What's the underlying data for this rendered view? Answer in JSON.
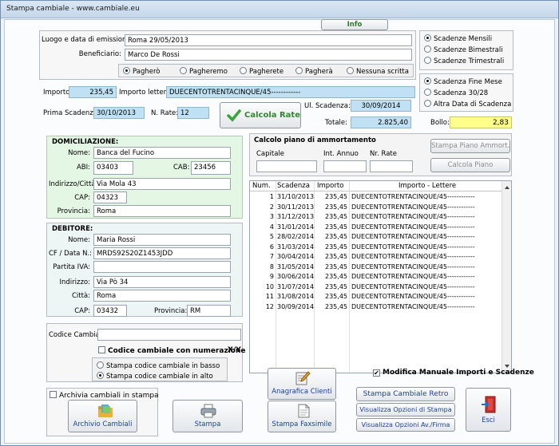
{
  "window": {
    "title": "Stampa cambiale - www.cambiale.eu"
  },
  "tabs": {
    "info_label": "Info"
  },
  "form": {
    "luogo_label": "Luogo e data di emissione:",
    "luogo_value": "Roma 29/05/2013",
    "beneficiario_label": "Beneficiario:",
    "beneficiario_value": "Marco De Rossi",
    "pagamento_options": [
      "Pagherò",
      "Pagheremo",
      "Pagherete",
      "Pagherà",
      "Nessuna scritta"
    ],
    "pagamento_selected": 0,
    "importo_label": "Importo:",
    "importo_value": "235,45",
    "importo_lettere_label": "Importo lettere:",
    "importo_lettere_value": "DUECENTOTRENTACINQUE/45------------",
    "prima_scadenza_label": "Prima Scadenza:",
    "prima_scadenza_value": "30/10/2013",
    "n_rate_label": "N. Rate:",
    "n_rate_value": "12",
    "calcola_rate_label": "Calcola Rate",
    "ul_scadenza_label": "Ul. Scadenza:",
    "ul_scadenza_value": "30/09/2014",
    "totale_label": "Totale:",
    "totale_value": "2.825,40",
    "bollo_label": "Bollo:",
    "bollo_value": "2,83"
  },
  "scadenze_freq": {
    "options": [
      "Scadenze Mensili",
      "Scadenze Bimestrali",
      "Scadenze Trimestrali"
    ],
    "selected": 0
  },
  "scadenze_tipo": {
    "options": [
      "Scadenza Fine Mese",
      "Scadenza 30/28",
      "Altra Data di Scadenza"
    ],
    "selected": 0
  },
  "domiciliazione": {
    "title": "DOMICILIAZIONE:",
    "nome_label": "Nome:",
    "nome_value": "Banca del Fucino",
    "abi_label": "ABI:",
    "abi_value": "03403",
    "cab_label": "CAB:",
    "cab_value": "23456",
    "indirizzo_label": "Indirizzo/Città:",
    "indirizzo_value": "Via Mola 43",
    "cap_label": "CAP:",
    "cap_value": "04323",
    "provincia_label": "Provincia:",
    "provincia_value": "Roma"
  },
  "debitore": {
    "title": "DEBITORE:",
    "nome_label": "Nome:",
    "nome_value": "Maria Rossi",
    "cf_label": "CF / Data N.:",
    "cf_value": "MRDS92S20Z1453JDD",
    "piva_label": "Partita IVA:",
    "piva_value": "",
    "indirizzo_label": "Indirizzo:",
    "indirizzo_value": "Via Pò 34",
    "citta_label": "Città:",
    "citta_value": "Roma",
    "cap_label": "CAP:",
    "cap_value": "03432",
    "provincia_label": "Provincia:",
    "provincia_value": "RM"
  },
  "codice": {
    "label": "Codice Cambiale:",
    "value": "",
    "numerazione_label": "Codice cambiale con numerazione",
    "xy_label": "X/Y",
    "options": [
      "Stampa codice cambiale in basso",
      "Stampa codice cambiale in alto"
    ],
    "selected": 1
  },
  "ammortamento": {
    "title": "Calcolo piano di ammortamento",
    "capitale_label": "Capitale",
    "capitale_value": "",
    "int_label": "Int. Annuo",
    "int_value": "",
    "nrate_label": "Nr. Rate",
    "nrate_value": "",
    "stampa_piano_label": "Stampa Piano Ammort.",
    "calcola_piano_label": "Calcola Piano"
  },
  "table": {
    "headers": [
      "Num.",
      "Scadenza",
      "Importo",
      "Importo - Lettere"
    ],
    "rows": [
      [
        "1",
        "31/10/2013",
        "235,45",
        "DUECENTOTRENTACINQUE/45------------"
      ],
      [
        "2",
        "30/11/2013",
        "235,45",
        "DUECENTOTRENTACINQUE/45------------"
      ],
      [
        "3",
        "31/12/2013",
        "235,45",
        "DUECENTOTRENTACINQUE/45------------"
      ],
      [
        "4",
        "31/01/2014",
        "235,45",
        "DUECENTOTRENTACINQUE/45------------"
      ],
      [
        "5",
        "28/02/2014",
        "235,45",
        "DUECENTOTRENTACINQUE/45------------"
      ],
      [
        "6",
        "31/03/2014",
        "235,45",
        "DUECENTOTRENTACINQUE/45------------"
      ],
      [
        "7",
        "30/04/2014",
        "235,45",
        "DUECENTOTRENTACINQUE/45------------"
      ],
      [
        "8",
        "31/05/2014",
        "235,45",
        "DUECENTOTRENTACINQUE/45------------"
      ],
      [
        "9",
        "30/06/2014",
        "235,45",
        "DUECENTOTRENTACINQUE/45------------"
      ],
      [
        "10",
        "31/07/2014",
        "235,45",
        "DUECENTOTRENTACINQUE/45------------"
      ],
      [
        "11",
        "31/08/2014",
        "235,45",
        "DUECENTOTRENTACINQUE/45------------"
      ],
      [
        "12",
        "30/09/2014",
        "235,45",
        "DUECENTOTRENTACINQUE/45------------"
      ]
    ]
  },
  "modifica_label": "Modifica Manuale Importi e Scadenze",
  "archivia_label": "Archivia cambiali in stampa",
  "buttons": {
    "archivio": "Archivio Cambiali",
    "stampa": "Stampa",
    "anagrafica": "Anagrafica Clienti",
    "faxsimile": "Stampa Faxsimile",
    "retro": "Stampa Cambiale Retro",
    "opzioni_stampa": "Visualizza Opzioni di Stampa",
    "opzioni_av": "Visualizza Opzioni Av./Firma",
    "esci": "Esci"
  },
  "icons": {
    "calcola": "green-checkmark-icon",
    "archivio": "folder-icon",
    "stampa": "printer-icon",
    "anagrafica": "edit-document-icon",
    "faxsimile": "document-icon",
    "esci": "exit-door-icon"
  }
}
